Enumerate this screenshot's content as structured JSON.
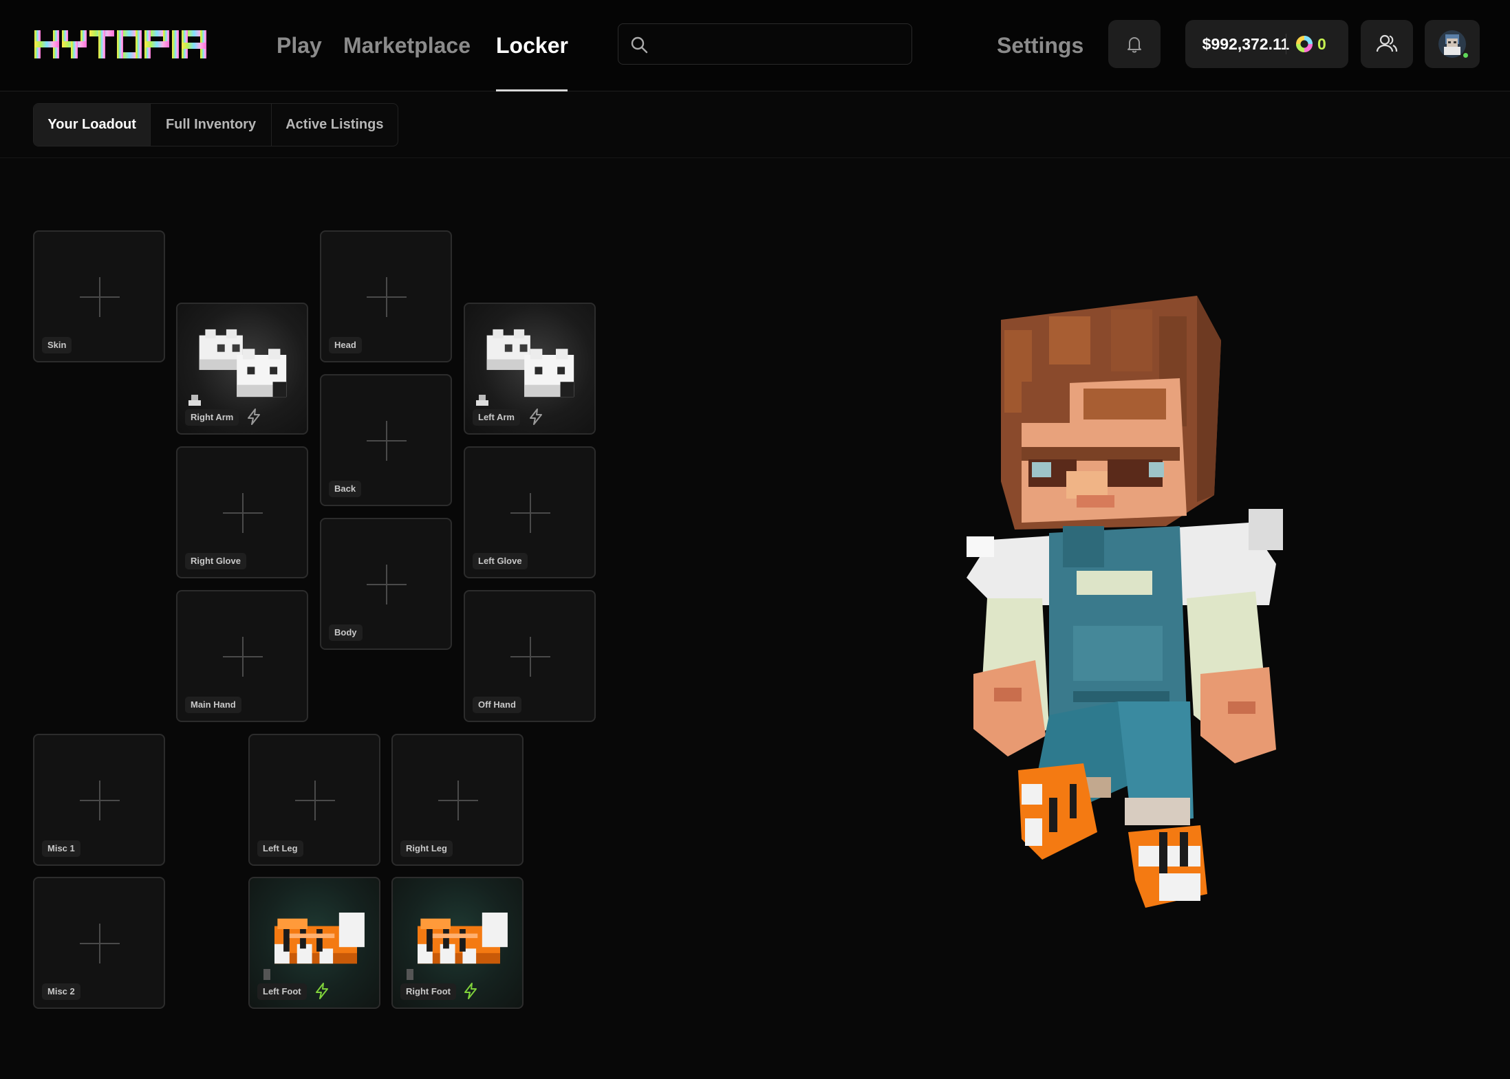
{
  "brand": {
    "logo_text": "HYTOPIA"
  },
  "nav": {
    "play": "Play",
    "marketplace": "Marketplace",
    "locker": "Locker",
    "settings": "Settings"
  },
  "search": {
    "placeholder": "",
    "value": ""
  },
  "wallet": {
    "balance": "$992,372.11",
    "coins": "0"
  },
  "tabs": {
    "loadout": "Your Loadout",
    "inventory": "Full Inventory",
    "listings": "Active Listings"
  },
  "slots": {
    "skin": "Skin",
    "right_arm": "Right Arm",
    "head": "Head",
    "left_arm": "Left Arm",
    "back": "Back",
    "right_glove": "Right Glove",
    "left_glove": "Left Glove",
    "body": "Body",
    "main_hand": "Main Hand",
    "off_hand": "Off Hand",
    "misc1": "Misc 1",
    "left_leg": "Left Leg",
    "right_leg": "Right Leg",
    "misc2": "Misc 2",
    "left_foot": "Left Foot",
    "right_foot": "Right Foot"
  },
  "icons": {
    "search": "search-icon",
    "bell": "bell-icon",
    "coin": "coin-icon",
    "friends": "friends-icon",
    "plus": "plus-icon",
    "bolt": "bolt-icon"
  },
  "colors": {
    "background": "#080808",
    "slot_bg": "#121212",
    "slot_border": "#2c2c2c",
    "accent_green": "#7fd13b",
    "coin_text": "#c6f050"
  }
}
